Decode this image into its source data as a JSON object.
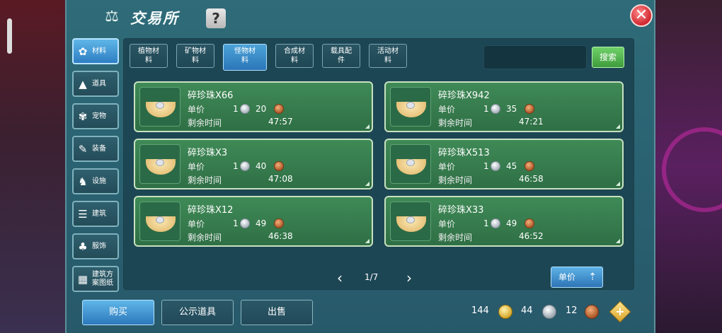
{
  "window": {
    "title": "交易所"
  },
  "help": {
    "label": "?"
  },
  "close": {
    "label": "✕"
  },
  "sidebar": {
    "items": [
      {
        "label": "材料",
        "icon": "材料-icon"
      },
      {
        "label": "道具",
        "icon": "道具-icon"
      },
      {
        "label": "宠物",
        "icon": "宠物-icon"
      },
      {
        "label": "装备",
        "icon": "装备-icon"
      },
      {
        "label": "设施",
        "icon": "设施-icon"
      },
      {
        "label": "建筑",
        "icon": "建筑-icon"
      },
      {
        "label": "服饰",
        "icon": "服饰-icon"
      },
      {
        "label": "建筑方\n案图纸",
        "icon": "建筑方案图纸-icon"
      }
    ],
    "active_index": 0
  },
  "tabs": {
    "items": [
      {
        "label": "植物材\n料"
      },
      {
        "label": "矿物材\n料"
      },
      {
        "label": "怪物材\n料"
      },
      {
        "label": "合成材\n料"
      },
      {
        "label": "载具配\n件"
      },
      {
        "label": "活动材\n料"
      }
    ],
    "active_index": 2
  },
  "search": {
    "value": "",
    "placeholder": "",
    "button_label": "搜索"
  },
  "listings": {
    "price_label": "单价",
    "time_label": "剩余时间",
    "items": [
      {
        "name": "碎珍珠X66",
        "silver": "1",
        "copper": "20",
        "time": "47:57"
      },
      {
        "name": "碎珍珠X942",
        "silver": "1",
        "copper": "35",
        "time": "47:21"
      },
      {
        "name": "碎珍珠X3",
        "silver": "1",
        "copper": "40",
        "time": "47:08"
      },
      {
        "name": "碎珍珠X513",
        "silver": "1",
        "copper": "45",
        "time": "46:58"
      },
      {
        "name": "碎珍珠X12",
        "silver": "1",
        "copper": "49",
        "time": "46:38"
      },
      {
        "name": "碎珍珠X33",
        "silver": "1",
        "copper": "49",
        "time": "46:52"
      }
    ]
  },
  "pager": {
    "text": "1/7",
    "prev": "‹",
    "next": "›"
  },
  "sort": {
    "label": "单价"
  },
  "bottom": {
    "tabs": [
      {
        "label": "购买"
      },
      {
        "label": "公示道具"
      },
      {
        "label": "出售"
      }
    ],
    "active_index": 0
  },
  "currency": {
    "gold": "144",
    "silver": "44",
    "copper": "12"
  },
  "colors": {
    "panel": "#2a6272",
    "card": "#3f8a57",
    "active_blue": "#2e7ec2",
    "search_green": "#3f9b3b"
  }
}
